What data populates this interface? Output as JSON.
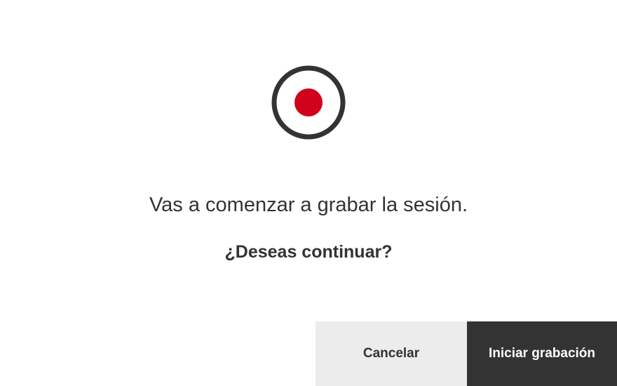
{
  "icon": {
    "name": "record-icon",
    "ring_color": "#333333",
    "dot_color": "#d0021b"
  },
  "dialog": {
    "message": "Vas a comenzar a grabar la sesión.",
    "question": "¿Deseas continuar?"
  },
  "buttons": {
    "cancel_label": "Cancelar",
    "start_label": "Iniciar grabación"
  },
  "colors": {
    "primary_button_bg": "#333333",
    "secondary_button_bg": "#ececec",
    "text": "#333333",
    "record_red": "#d0021b"
  }
}
